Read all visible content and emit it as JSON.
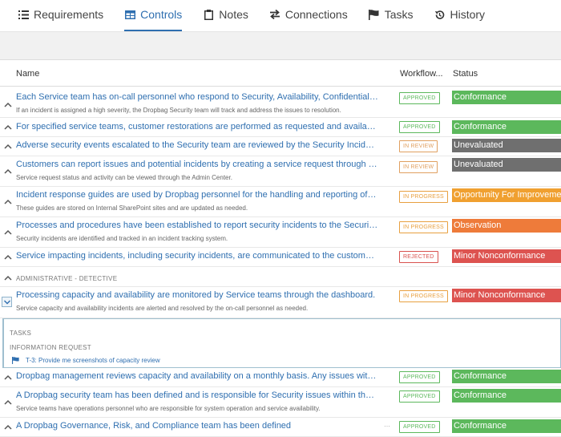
{
  "tabs": [
    {
      "label": "Requirements",
      "icon": "list-icon"
    },
    {
      "label": "Controls",
      "icon": "table-icon"
    },
    {
      "label": "Notes",
      "icon": "clipboard-icon"
    },
    {
      "label": "Connections",
      "icon": "arrows-icon"
    },
    {
      "label": "Tasks",
      "icon": "flag-icon"
    },
    {
      "label": "History",
      "icon": "history-icon"
    }
  ],
  "table": {
    "col_name": "Name",
    "col_workflow": "Workflow...",
    "col_status": "Status"
  },
  "rows": [
    {
      "title": "Each Service team has on-call personnel who respond to Security, Availability, Confidentiality, ...",
      "desc": "If an incident is assigned a high severity, the Dropbag Security team will track and address the issues to resolution.",
      "workflow": "APPROVED",
      "status": "Conformance"
    },
    {
      "title": "For specified service teams, customer restorations are performed as requested and available p...",
      "desc": "",
      "workflow": "APPROVED",
      "status": "Conformance"
    },
    {
      "title": "Adverse security events escalated to the Security team are reviewed by the Security Incident R...",
      "desc": "",
      "workflow": "IN REVIEW",
      "status": "Unevaluated"
    },
    {
      "title": "Customers can report issues and potential incidents by creating a service request through the ...",
      "desc": "Service request status and activity can be viewed through the Admin Center.",
      "workflow": "IN REVIEW",
      "status": "Unevaluated"
    },
    {
      "title": "Incident response guides are used by Dropbag personnel for the handling and reporting of sec...",
      "desc": "These guides are stored on Internal SharePoint sites and are updated as needed.",
      "workflow": "IN PROGRESS",
      "status": "Opportunity For Improvement"
    },
    {
      "title": "Processes and procedures have been established to report security incidents to the Security te...",
      "desc": "Security incidents are identified and tracked in an incident tracking system.",
      "workflow": "IN PROGRESS",
      "status": "Observation"
    },
    {
      "title": "Service impacting incidents, including security incidents, are communicated to the customer th...",
      "desc": "",
      "workflow": "REJECTED",
      "status": "Minor Nonconformance"
    }
  ],
  "section_label": "ADMINISTRATIVE - DETECTIVE",
  "expanded_row": {
    "title": "Processing capacity and availability are monitored by Service teams through the dashboard.",
    "desc": "Service capacity and availability incidents are alerted and resolved by the on-call personnel as needed.",
    "workflow": "IN PROGRESS",
    "status": "Minor Nonconformance"
  },
  "tasks_panel": {
    "heading": "TASKS",
    "type": "INFORMATION REQUEST",
    "task": "T-3: Provide me screenshots of capacity review"
  },
  "rows_after": [
    {
      "title": "Dropbag management reviews capacity and availability on a monthly basis. Any issues with or...",
      "desc": "",
      "workflow": "APPROVED",
      "status": "Conformance"
    },
    {
      "title": "A Dropbag security team has been defined and is responsible for Security issues within the Dr...",
      "desc": "Service teams have operations personnel who are responsible for system operation and service availability.",
      "workflow": "APPROVED",
      "status": "Conformance"
    },
    {
      "title": "A Dropbag Governance, Risk, and Compliance team has been defined",
      "desc": "",
      "workflow": "APPROVED",
      "status": "Conformance"
    }
  ],
  "colors": {
    "approved": "#5cb85c",
    "in_review": "#e0a060",
    "in_progress": "#e8a040",
    "rejected": "#d9534f",
    "conformance": "#5cb85c",
    "unevaluated": "#6f6f6f",
    "opportunity": "#f0a030",
    "observation": "#ee7b3a",
    "minor_nc": "#dd5350"
  }
}
